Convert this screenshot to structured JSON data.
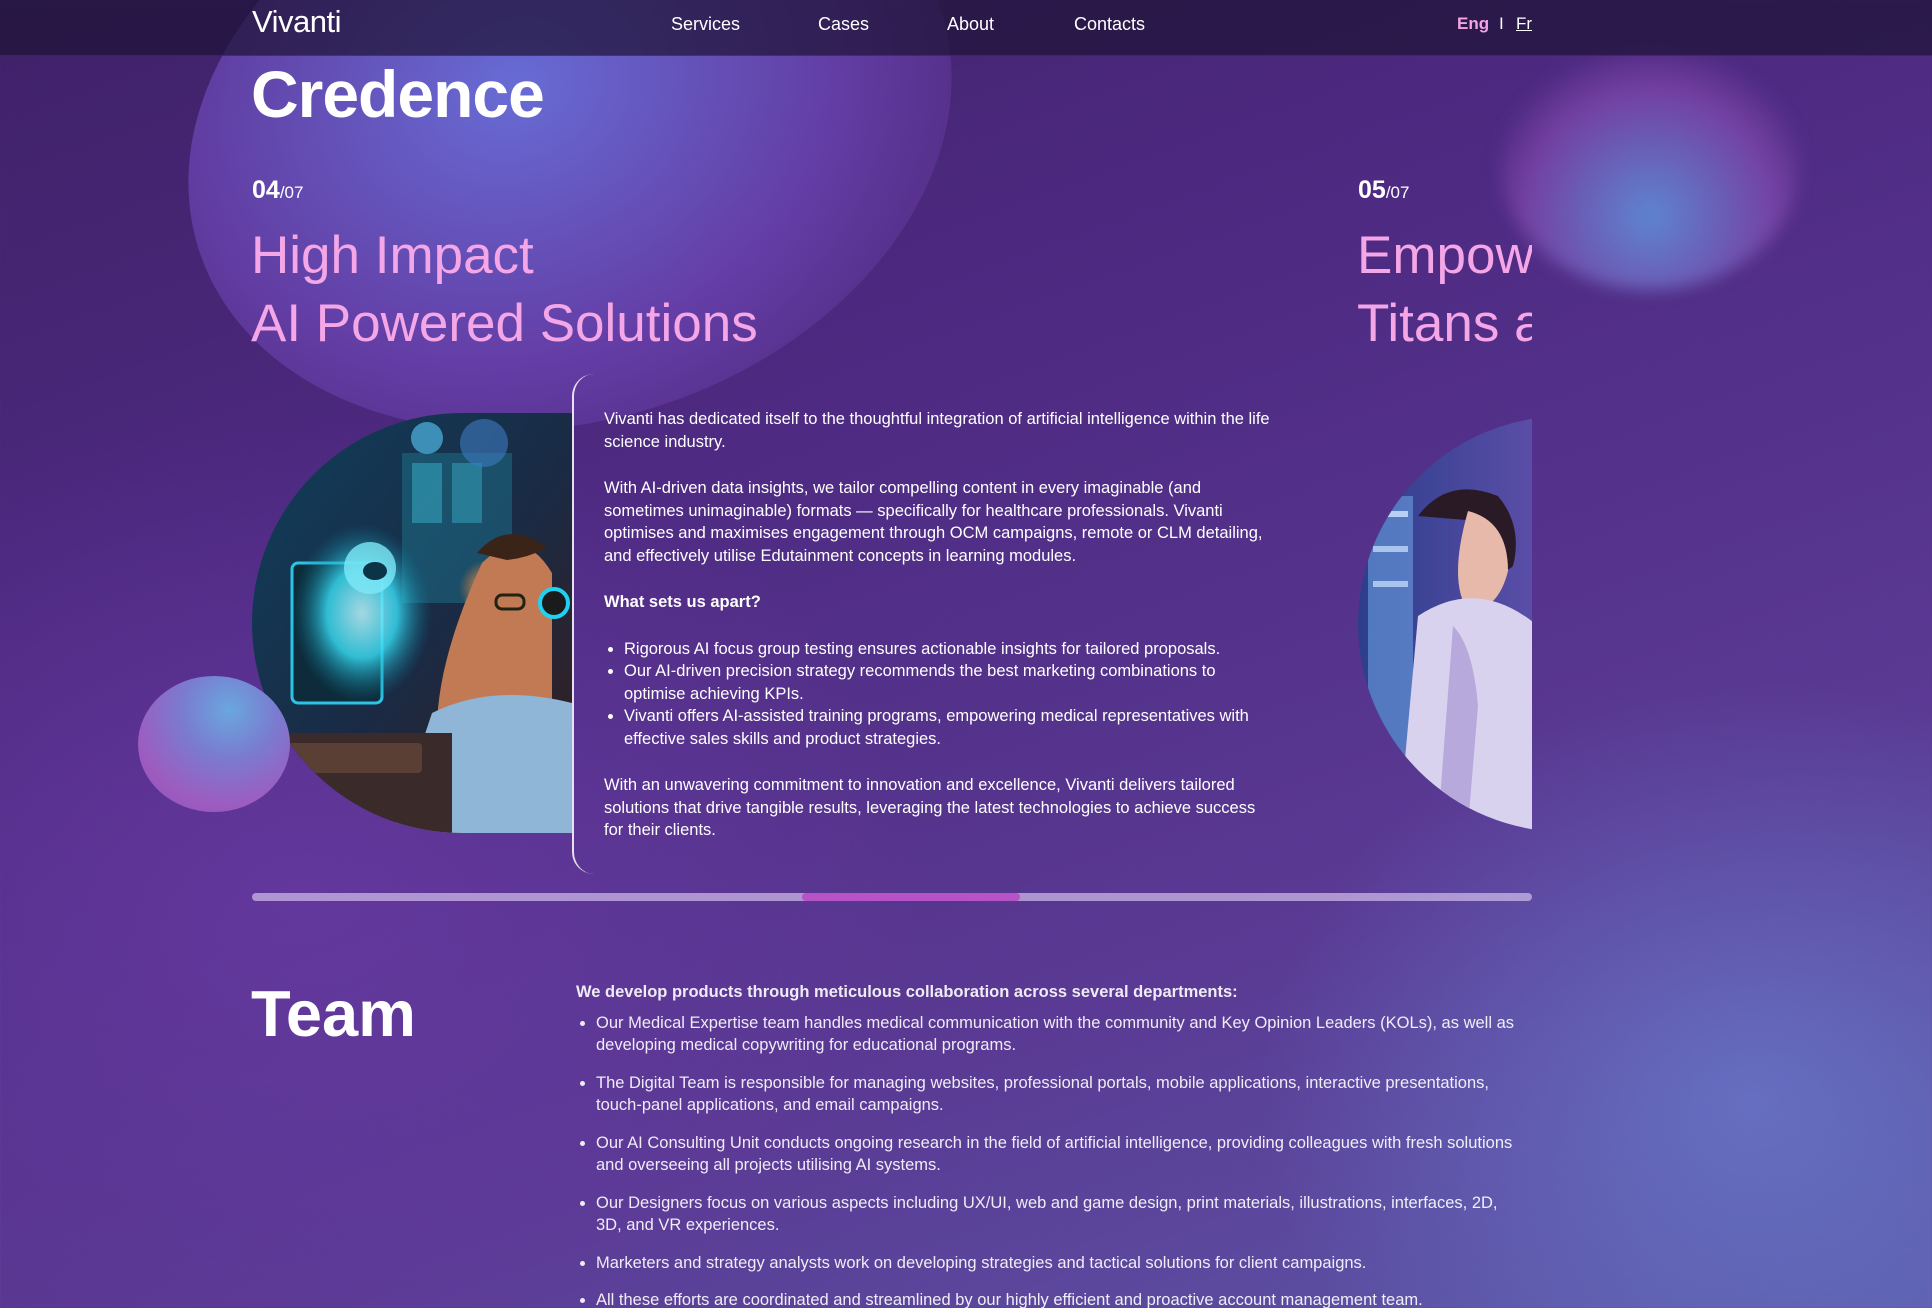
{
  "nav": {
    "logo": "Vivanti",
    "links": [
      "Services",
      "Cases",
      "About",
      "Contacts"
    ],
    "lang_active": "Eng",
    "lang_separator": "I",
    "lang_other": "Fr"
  },
  "section_title": "Credence",
  "slides": [
    {
      "counter_current": "04",
      "counter_total": "/07",
      "title_line1": "High Impact",
      "title_line2": "AI Powered Solutions",
      "paragraphs": [
        "Vivanti has dedicated itself to the thoughtful integration of artificial intelligence within the life science industry.",
        "With AI-driven data insights, we tailor compelling content in every imaginable (and sometimes unimaginable) formats — specifically for healthcare professionals. Vivanti optimises and maximises engagement through OCM campaigns, remote or CLM detailing, and effectively utilise Edutainment concepts in learning modules."
      ],
      "subheading": "What sets us apart?",
      "bullets": [
        "Rigorous AI focus group testing ensures actionable insights for tailored proposals.",
        "Our AI-driven precision strategy recommends the best marketing combinations to optimise achieving KPIs.",
        "Vivanti offers AI-assisted training programs, empowering medical representatives with effective sales skills and product strategies."
      ],
      "closing": "With an unwavering commitment to innovation and excellence, Vivanti delivers tailored solutions that drive tangible results, leveraging the latest technologies to achieve success for their clients."
    },
    {
      "counter_current": "05",
      "counter_total": "/07",
      "title_line1": "Empow",
      "title_line2": "Titans a"
    }
  ],
  "carousel": {
    "progress_start": 0.43,
    "progress_end": 0.6
  },
  "team": {
    "title": "Team",
    "lead": "We develop products through meticulous collaboration across several departments:",
    "items": [
      "Our Medical Expertise team handles medical communication with the community and Key Opinion Leaders (KOLs), as well as developing medical copywriting for educational programs.",
      "The Digital Team is responsible for managing websites, professional portals, mobile applications, interactive presentations, touch-panel applications, and email campaigns.",
      "Our AI Consulting Unit conducts ongoing research in the field of artificial intelligence, providing colleagues with fresh solutions and overseeing all projects utilising AI systems.",
      "Our Designers focus on various aspects including UX/UI, web and game design, print materials, illustrations, interfaces, 2D, 3D, and VR experiences.",
      "Marketers and strategy analysts work on developing strategies and tactical solutions for client campaigns.",
      "All these efforts are coordinated and streamlined by our highly efficient and proactive account management team."
    ]
  },
  "colors": {
    "accent_pink": "#f4a6e6",
    "progress_fill": "#b553c7",
    "nav_bg": "#1e1437"
  }
}
